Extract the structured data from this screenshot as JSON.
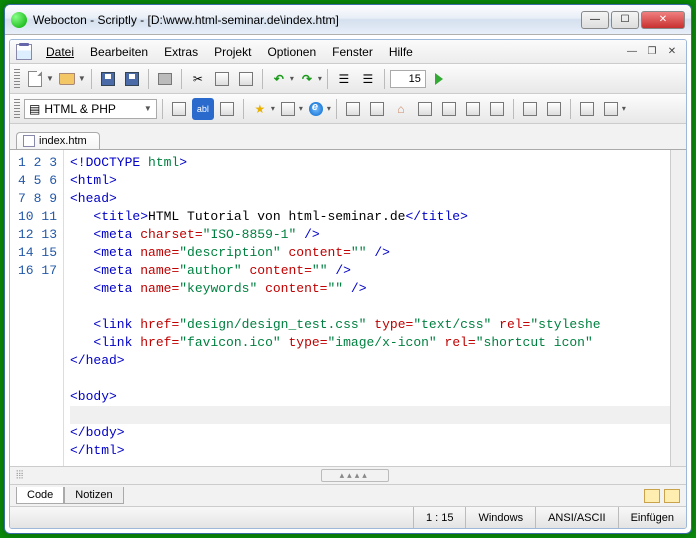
{
  "title": "Webocton - Scriptly - [D:\\www.html-seminar.de\\index.htm]",
  "menu": {
    "datei": "Datei",
    "bearbeiten": "Bearbeiten",
    "extras": "Extras",
    "projekt": "Projekt",
    "optionen": "Optionen",
    "fenster": "Fenster",
    "hilfe": "Hilfe"
  },
  "toolbar_line_input": "15",
  "language": "HTML & PHP",
  "tab_filename": "index.htm",
  "code_lines": 17,
  "code_html": "<span class='tag'>&lt;!DOCTYPE</span> <span class='val'>html</span><span class='tag'>&gt;</span>\n<span class='tag'>&lt;html&gt;</span>\n<span class='tag'>&lt;head&gt;</span>\n   <span class='tag'>&lt;title&gt;</span>HTML Tutorial von html-seminar.de<span class='tag'>&lt;/title&gt;</span>\n   <span class='tag'>&lt;meta</span> <span class='attr'>charset=</span><span class='val'>\"ISO-8859-1\"</span> <span class='tag'>/&gt;</span>\n   <span class='tag'>&lt;meta</span> <span class='attr'>name=</span><span class='val'>\"description\"</span> <span class='attr'>content=</span><span class='val'>\"\"</span> <span class='tag'>/&gt;</span>\n   <span class='tag'>&lt;meta</span> <span class='attr'>name=</span><span class='val'>\"author\"</span> <span class='attr'>content=</span><span class='val'>\"\"</span> <span class='tag'>/&gt;</span>\n   <span class='tag'>&lt;meta</span> <span class='attr'>name=</span><span class='val'>\"keywords\"</span> <span class='attr'>content=</span><span class='val'>\"\"</span> <span class='tag'>/&gt;</span>\n\n   <span class='tag'>&lt;link</span> <span class='attr'>href=</span><span class='val'>\"design/design_test.css\"</span> <span class='attr'>type=</span><span class='val'>\"text/css\"</span> <span class='attr'>rel=</span><span class='val'>\"styleshe</span>\n   <span class='tag'>&lt;link</span> <span class='attr'>href=</span><span class='val'>\"favicon.ico\"</span> <span class='attr'>type=</span><span class='val'>\"image/x-icon\"</span> <span class='attr'>rel=</span><span class='val'>\"shortcut icon\"</span>\n<span class='tag'>&lt;/head&gt;</span>\n\n<span class='tag'>&lt;body&gt;</span>\n<span class='current-line'> </span>\n<span class='tag'>&lt;/body&gt;</span>\n<span class='tag'>&lt;/html&gt;</span>",
  "bottom_tabs": {
    "code": "Code",
    "notizen": "Notizen"
  },
  "status": {
    "cursor": "1 : 15",
    "eol": "Windows",
    "encoding": "ANSI/ASCII",
    "mode": "Einfügen"
  }
}
